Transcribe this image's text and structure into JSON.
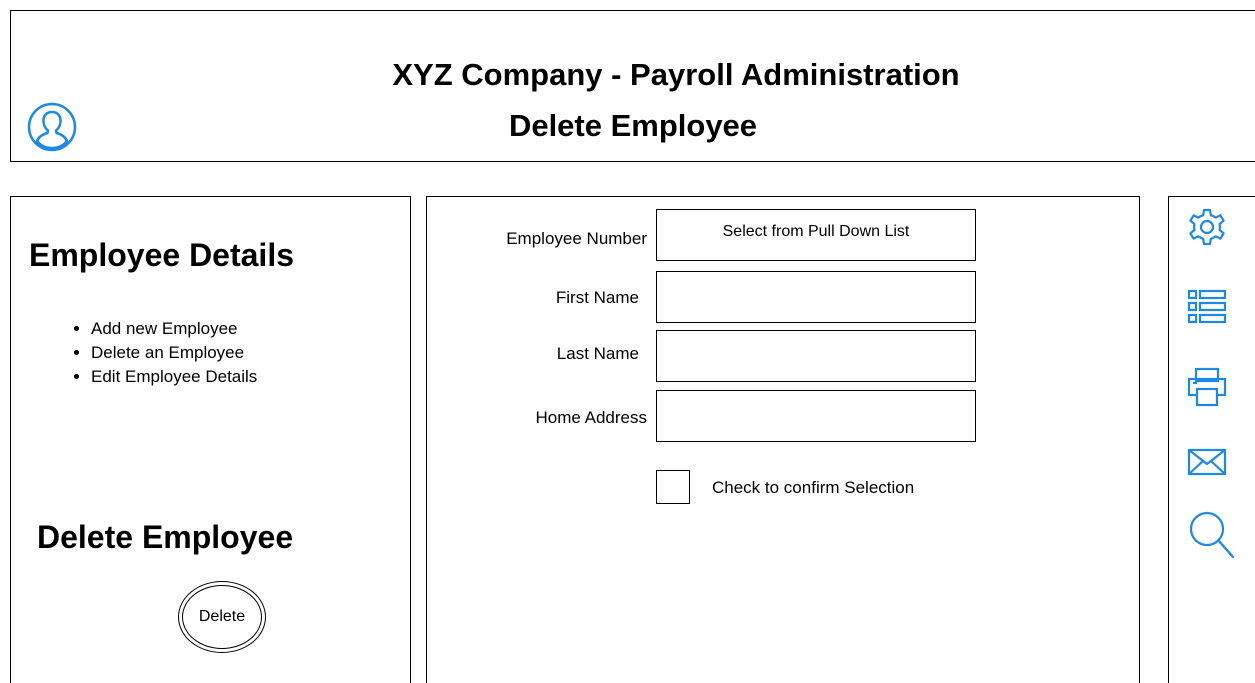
{
  "header": {
    "title": "XYZ Company - Payroll Administration",
    "subtitle": "Delete Employee"
  },
  "sidebar": {
    "title": "Employee Details",
    "items": [
      {
        "label": "Add new Employee"
      },
      {
        "label": "Delete an Employee"
      },
      {
        "label": "Edit Employee Details"
      }
    ],
    "delete_section_title": "Delete Employee",
    "delete_button_label": "Delete"
  },
  "form": {
    "employee_number_label": "Employee Number",
    "employee_number_value": "Select from Pull Down List",
    "first_name_label": "First Name",
    "first_name_value": "",
    "last_name_label": "Last Name",
    "last_name_value": "",
    "home_address_label": "Home Address",
    "home_address_value": "",
    "confirm_label": "Check to confirm Selection"
  },
  "toolbar": {
    "icons": [
      "gear-icon",
      "list-icon",
      "printer-icon",
      "mail-icon",
      "search-icon"
    ]
  },
  "colors": {
    "accent": "#1E88E5"
  }
}
